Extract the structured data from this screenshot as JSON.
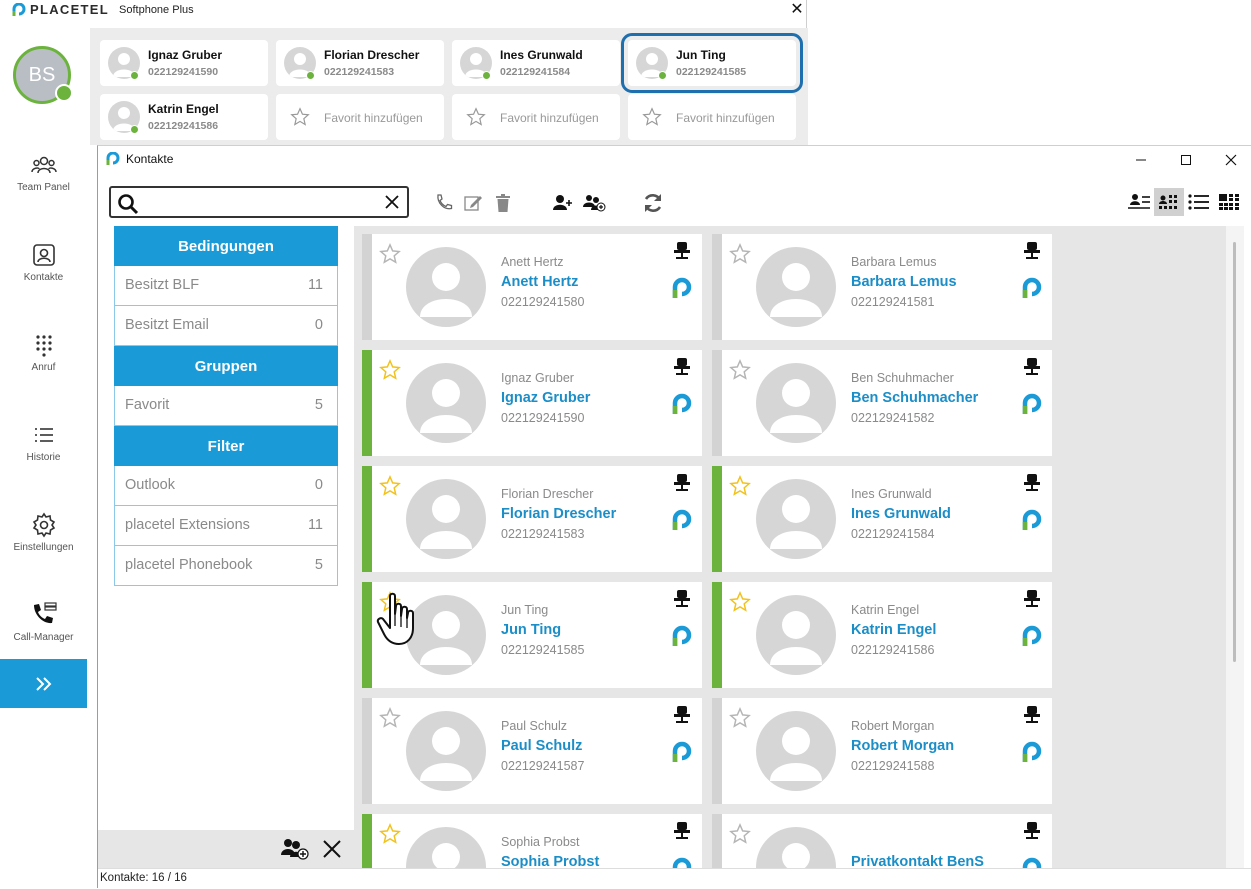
{
  "softphone": {
    "brand": "PLACETEL",
    "product": "Softphone Plus",
    "avatar_initials": "BS",
    "nav": [
      {
        "label": "Team Panel",
        "icon": "team-icon"
      },
      {
        "label": "Kontakte",
        "icon": "contacts-icon"
      },
      {
        "label": "Anruf",
        "icon": "dialpad-icon"
      },
      {
        "label": "Historie",
        "icon": "history-icon"
      },
      {
        "label": "Einstellungen",
        "icon": "gear-icon"
      },
      {
        "label": "Call-Manager",
        "icon": "call-manager-icon"
      }
    ],
    "favorites": [
      {
        "name": "Ignaz Gruber",
        "number": "022129241590"
      },
      {
        "name": "Florian Drescher",
        "number": "022129241583"
      },
      {
        "name": "Ines Grunwald",
        "number": "022129241584"
      },
      {
        "name": "Jun Ting",
        "number": "022129241585"
      },
      {
        "name": "Katrin Engel",
        "number": "022129241586"
      }
    ],
    "add_favorite_label": "Favorit hinzufügen"
  },
  "kontakte": {
    "title": "Kontakte",
    "search": {
      "value": "",
      "placeholder": ""
    },
    "sections": {
      "bedingungen": "Bedingungen",
      "gruppen": "Gruppen",
      "filter": "Filter"
    },
    "filters": [
      {
        "label": "Besitzt BLF",
        "count": "11"
      },
      {
        "label": "Besitzt Email",
        "count": "0"
      },
      {
        "label": "Favorit",
        "count": "5"
      },
      {
        "label": "Outlook",
        "count": "0"
      },
      {
        "label": "placetel Extensions",
        "count": "11"
      },
      {
        "label": "placetel Phonebook",
        "count": "5"
      }
    ],
    "status": "Kontakte: 16 / 16",
    "contacts": [
      {
        "sub": "Anett Hertz",
        "name": "Anett Hertz",
        "number": "022129241580",
        "favorite": false
      },
      {
        "sub": "Barbara Lemus",
        "name": "Barbara Lemus",
        "number": "022129241581",
        "favorite": false
      },
      {
        "sub": "Ignaz Gruber",
        "name": "Ignaz Gruber",
        "number": "022129241590",
        "favorite": true
      },
      {
        "sub": "Ben Schuhmacher",
        "name": "Ben Schuhmacher",
        "number": "022129241582",
        "favorite": false
      },
      {
        "sub": "Florian Drescher",
        "name": "Florian Drescher",
        "number": "022129241583",
        "favorite": true
      },
      {
        "sub": "Ines Grunwald",
        "name": "Ines Grunwald",
        "number": "022129241584",
        "favorite": true
      },
      {
        "sub": "Jun Ting",
        "name": "Jun Ting",
        "number": "022129241585",
        "favorite": true
      },
      {
        "sub": "Katrin Engel",
        "name": "Katrin Engel",
        "number": "022129241586",
        "favorite": true
      },
      {
        "sub": "Paul Schulz",
        "name": "Paul Schulz",
        "number": "022129241587",
        "favorite": false
      },
      {
        "sub": "Robert Morgan",
        "name": "Robert Morgan",
        "number": "022129241588",
        "favorite": false
      },
      {
        "sub": "Sophia Probst",
        "name": "Sophia Probst",
        "number": "",
        "favorite": true
      },
      {
        "sub": "",
        "name": "Privatkontakt BenS",
        "number": "",
        "favorite": false
      }
    ]
  },
  "colors": {
    "accent": "#1a9ad6",
    "online": "#6cb33e",
    "favorite_star": "#f2c21b",
    "selected_outline": "#1f6fae"
  }
}
